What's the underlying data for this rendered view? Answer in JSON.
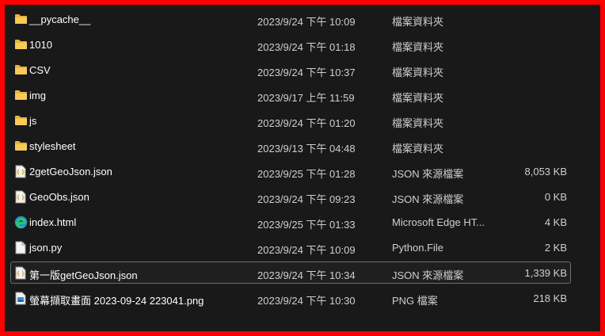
{
  "files": [
    {
      "name": "__pycache__",
      "date": "2023/9/24 下午 10:09",
      "type": "檔案資料夾",
      "size": "",
      "icon": "folder-icon"
    },
    {
      "name": "1010",
      "date": "2023/9/24 下午 01:18",
      "type": "檔案資料夾",
      "size": "",
      "icon": "folder-icon"
    },
    {
      "name": "CSV",
      "date": "2023/9/24 下午 10:37",
      "type": "檔案資料夾",
      "size": "",
      "icon": "folder-icon"
    },
    {
      "name": "img",
      "date": "2023/9/17 上午 11:59",
      "type": "檔案資料夾",
      "size": "",
      "icon": "folder-icon"
    },
    {
      "name": "js",
      "date": "2023/9/24 下午 01:20",
      "type": "檔案資料夾",
      "size": "",
      "icon": "folder-icon"
    },
    {
      "name": "stylesheet",
      "date": "2023/9/13 下午 04:48",
      "type": "檔案資料夾",
      "size": "",
      "icon": "folder-icon"
    },
    {
      "name": "2getGeoJson.json",
      "date": "2023/9/25 下午 01:28",
      "type": "JSON 來源檔案",
      "size": "8,053 KB",
      "icon": "json-file-icon"
    },
    {
      "name": "GeoObs.json",
      "date": "2023/9/24 下午 09:23",
      "type": "JSON 來源檔案",
      "size": "0 KB",
      "icon": "json-file-icon"
    },
    {
      "name": "index.html",
      "date": "2023/9/25 下午 01:33",
      "type": "Microsoft Edge HT...",
      "size": "4 KB",
      "icon": "edge-icon"
    },
    {
      "name": "json.py",
      "date": "2023/9/24 下午 10:09",
      "type": "Python.File",
      "size": "2 KB",
      "icon": "file-icon"
    },
    {
      "name": "第一版getGeoJson.json",
      "date": "2023/9/24 下午 10:34",
      "type": "JSON 來源檔案",
      "size": "1,339 KB",
      "icon": "json-file-icon"
    },
    {
      "name": "螢幕擷取畫面 2023-09-24 223041.png",
      "date": "2023/9/24 下午 10:30",
      "type": "PNG 檔案",
      "size": "218 KB",
      "icon": "image-file-icon"
    }
  ],
  "selected_index": 10,
  "colors": {
    "background": "#191919",
    "border": "#ff0000",
    "folder": "#f5c342",
    "text": "#ffffff"
  }
}
